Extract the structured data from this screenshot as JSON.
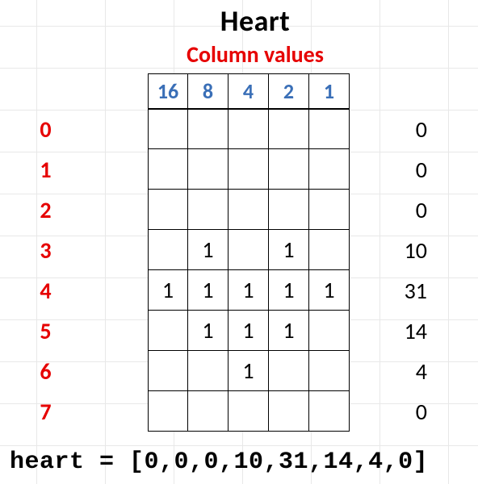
{
  "title": "Heart",
  "subtitle": "Column values",
  "column_values": [
    "16",
    "8",
    "4",
    "2",
    "1"
  ],
  "rows": [
    {
      "label": "0",
      "cells": [
        "",
        "",
        "",
        "",
        ""
      ],
      "sum": "0"
    },
    {
      "label": "1",
      "cells": [
        "",
        "",
        "",
        "",
        ""
      ],
      "sum": "0"
    },
    {
      "label": "2",
      "cells": [
        "",
        "",
        "",
        "",
        ""
      ],
      "sum": "0"
    },
    {
      "label": "3",
      "cells": [
        "",
        "1",
        "",
        "1",
        ""
      ],
      "sum": "10"
    },
    {
      "label": "4",
      "cells": [
        "1",
        "1",
        "1",
        "1",
        "1"
      ],
      "sum": "31"
    },
    {
      "label": "5",
      "cells": [
        "",
        "1",
        "1",
        "1",
        ""
      ],
      "sum": "14"
    },
    {
      "label": "6",
      "cells": [
        "",
        "",
        "1",
        "",
        ""
      ],
      "sum": "4"
    },
    {
      "label": "7",
      "cells": [
        "",
        "",
        "",
        "",
        ""
      ],
      "sum": "0"
    }
  ],
  "code": "heart = [0,0,0,10,31,14,4,0]"
}
